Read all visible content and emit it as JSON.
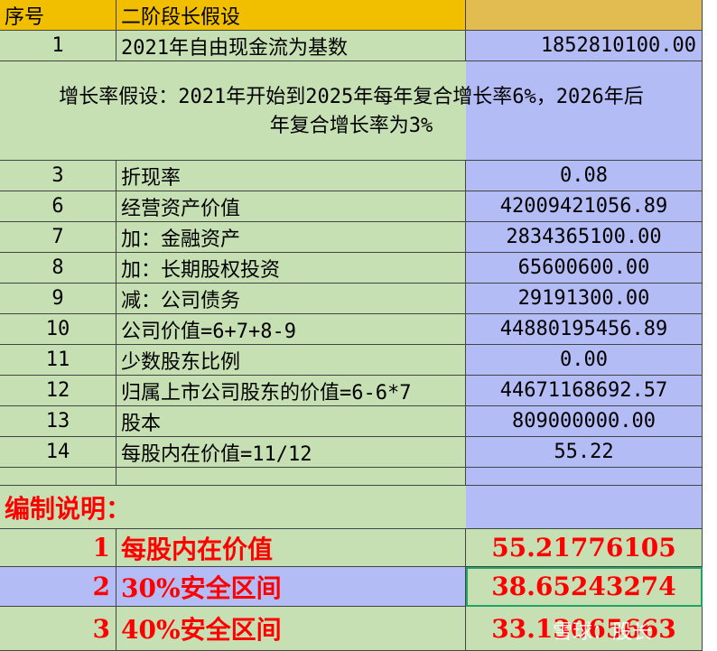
{
  "header": {
    "col_a": "序号",
    "col_b": "二阶段长假设",
    "col_c": ""
  },
  "row1": {
    "a": "1",
    "b": "2021年自由现金流为基数",
    "c": "1852810100.00"
  },
  "assumption": {
    "line1": "增长率假设：2021年开始到2025年每年复合增长率6%，2026年后",
    "line2": "年复合增长率为3%"
  },
  "rows": [
    {
      "a": "3",
      "b": "折现率",
      "c": "0.08"
    },
    {
      "a": "6",
      "b": "经营资产价值",
      "c": "42009421056.89"
    },
    {
      "a": "7",
      "b": "加：金融资产",
      "c": "2834365100.00"
    },
    {
      "a": "8",
      "b": "加：长期股权投资",
      "c": "65600600.00"
    },
    {
      "a": "9",
      "b": "减：公司债务",
      "c": "29191300.00"
    },
    {
      "a": "10",
      "b": "公司价值=6+7+8-9",
      "c": "44880195456.89"
    },
    {
      "a": "11",
      "b": "少数股东比例",
      "c": "0.00"
    },
    {
      "a": "12",
      "b": "归属上市公司股东的价值=6-6*7",
      "c": "44671168692.57"
    },
    {
      "a": "13",
      "b": "股本",
      "c": "809000000.00"
    },
    {
      "a": "14",
      "b": "每股内在价值=11/12",
      "c": "55.22"
    }
  ],
  "notes_title": "编制说明：",
  "notes": [
    {
      "num": "1",
      "label": "每股内在价值",
      "value": "55.21776105"
    },
    {
      "num": "2",
      "label": "30%安全区间",
      "value": "38.65243274"
    },
    {
      "num": "3",
      "label": "40%安全区间",
      "value": "33.13065663"
    }
  ],
  "watermark": "雪球：股长"
}
